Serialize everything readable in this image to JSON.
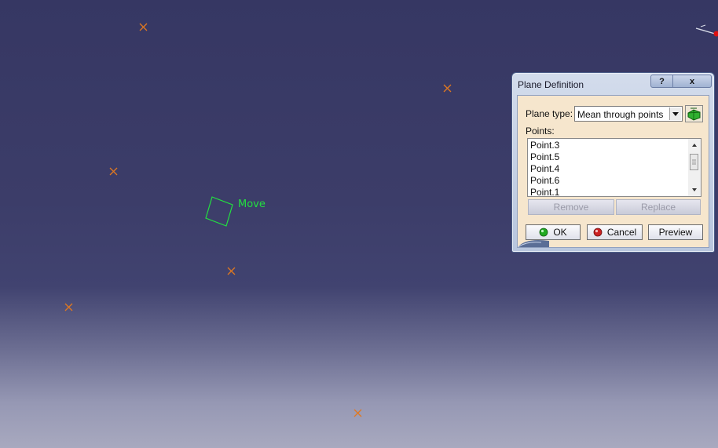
{
  "viewport": {
    "background_top": "#363763",
    "background_bottom": "#a8a9bf",
    "point_marker_color": "#e07820",
    "move_label": "Move",
    "move_color": "#22e040"
  },
  "dialog": {
    "title": "Plane Definition",
    "help_label": "?",
    "close_label": "x",
    "plane_type_label": "Plane type:",
    "plane_type_value": "Mean through points",
    "points_label": "Points:",
    "points": [
      "Point.3",
      "Point.5",
      "Point.4",
      "Point.6",
      "Point.1"
    ],
    "remove_label": "Remove",
    "replace_label": "Replace",
    "ok_label": "OK",
    "cancel_label": "Cancel",
    "preview_label": "Preview",
    "ok_icon_color": "#22aa22",
    "cancel_icon_color": "#cc2222",
    "client_background": "#f6e6cd"
  }
}
